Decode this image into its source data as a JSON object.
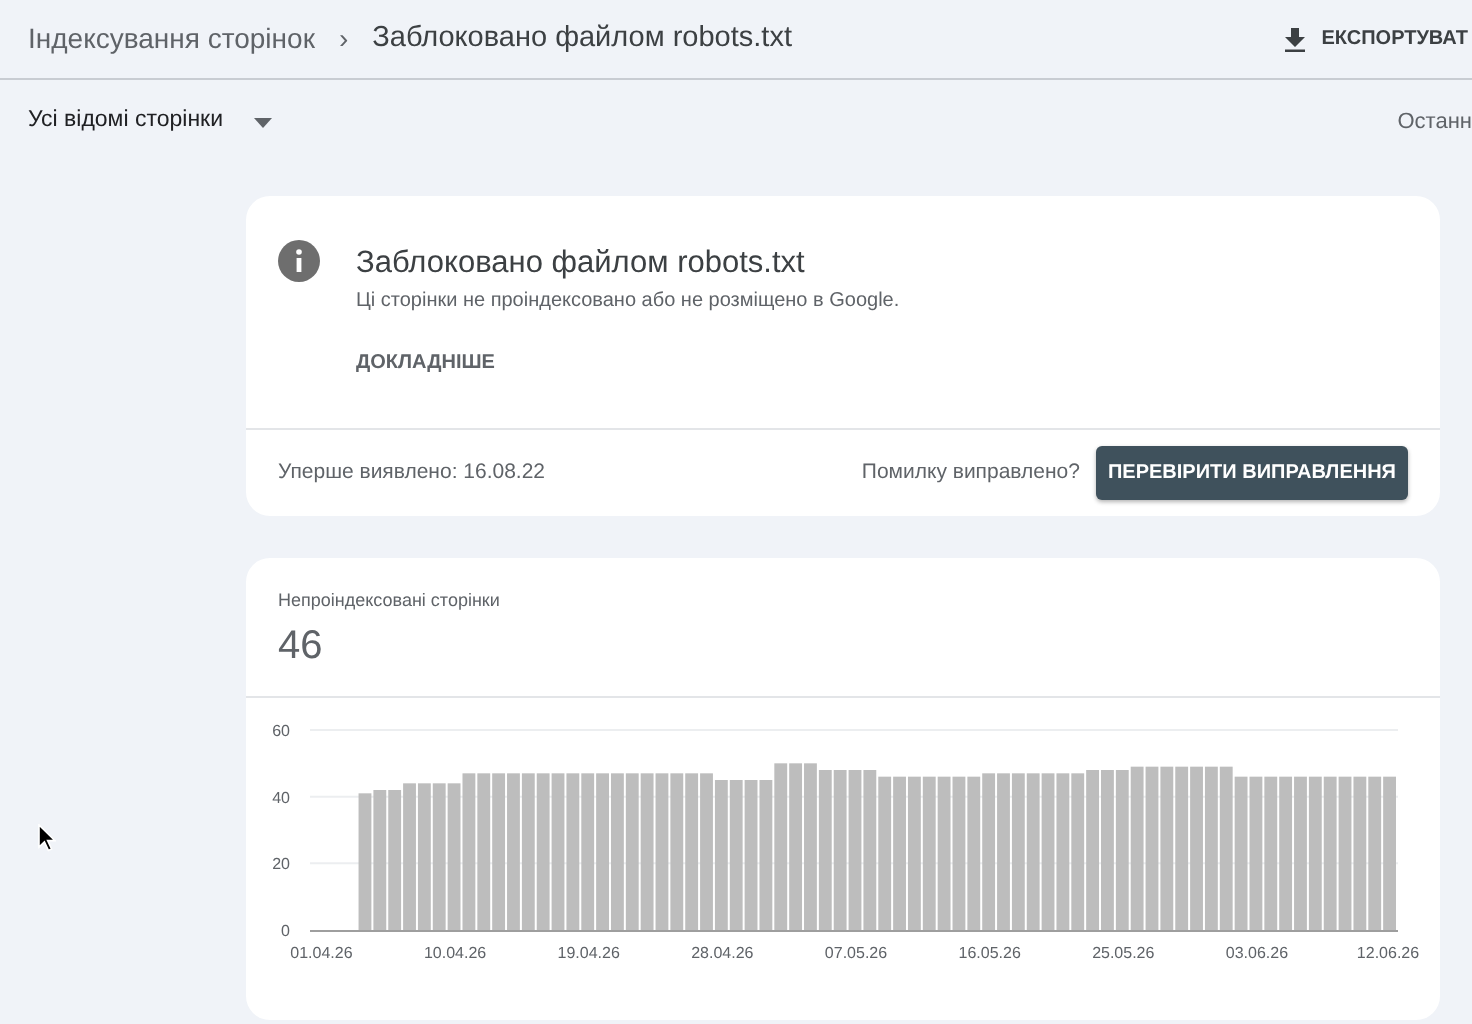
{
  "breadcrumb": [
    "Індексування сторінок",
    "Заблоковано файлом robots.txt"
  ],
  "breadcrumb_separator": "›",
  "export_button": "ЕКСПОРТУВАТ",
  "filter": {
    "label": "Усі відомі сторінки"
  },
  "right_label": "Останн",
  "issue_card": {
    "title": "Заблоковано файлом robots.txt",
    "description": "Ці сторінки не проіндексовано або не розміщено в Google.",
    "link": "ДОКЛАДНІШЕ",
    "first_detected": "Уперше виявлено: 16.08.22",
    "fixed_question": "Помилку виправлено?",
    "validate_button": "ПЕРЕВІРИТИ ВИПРАВЛЕННЯ"
  },
  "chart_card": {
    "label": "Непроіндексовані сторінки",
    "count": "46",
    "chart_data": {
      "type": "bar",
      "categories": [
        "01.04.26",
        null,
        null,
        null,
        null,
        null,
        null,
        null,
        null,
        "10.04.26",
        null,
        null,
        null,
        null,
        null,
        null,
        null,
        null,
        "19.04.26",
        null,
        null,
        null,
        null,
        null,
        null,
        null,
        null,
        "28.04.26",
        null,
        null,
        null,
        null,
        null,
        null,
        null,
        null,
        "07.05.26",
        null,
        null,
        null,
        null,
        null,
        null,
        null,
        null,
        "16.05.26",
        null,
        null,
        null,
        null,
        null,
        null,
        null,
        null,
        "25.05.26",
        null,
        null,
        null,
        null,
        null,
        null,
        null,
        null,
        "03.06.26",
        null,
        null,
        null,
        null,
        null,
        null,
        null,
        null,
        "12.06.26"
      ],
      "values": [
        null,
        null,
        null,
        41,
        42,
        42,
        44,
        44,
        44,
        44,
        47,
        47,
        47,
        47,
        47,
        47,
        47,
        47,
        47,
        47,
        47,
        47,
        47,
        47,
        47,
        47,
        47,
        45,
        45,
        45,
        45,
        50,
        50,
        50,
        48,
        48,
        48,
        48,
        46,
        46,
        46,
        46,
        46,
        46,
        46,
        47,
        47,
        47,
        47,
        47,
        47,
        47,
        48,
        48,
        48,
        49,
        49,
        49,
        49,
        49,
        49,
        49,
        46,
        46,
        46,
        46,
        46,
        46,
        46,
        46,
        46,
        46,
        46
      ],
      "ylim": [
        0,
        60
      ],
      "yticks": [
        0,
        20,
        40,
        60
      ]
    }
  }
}
